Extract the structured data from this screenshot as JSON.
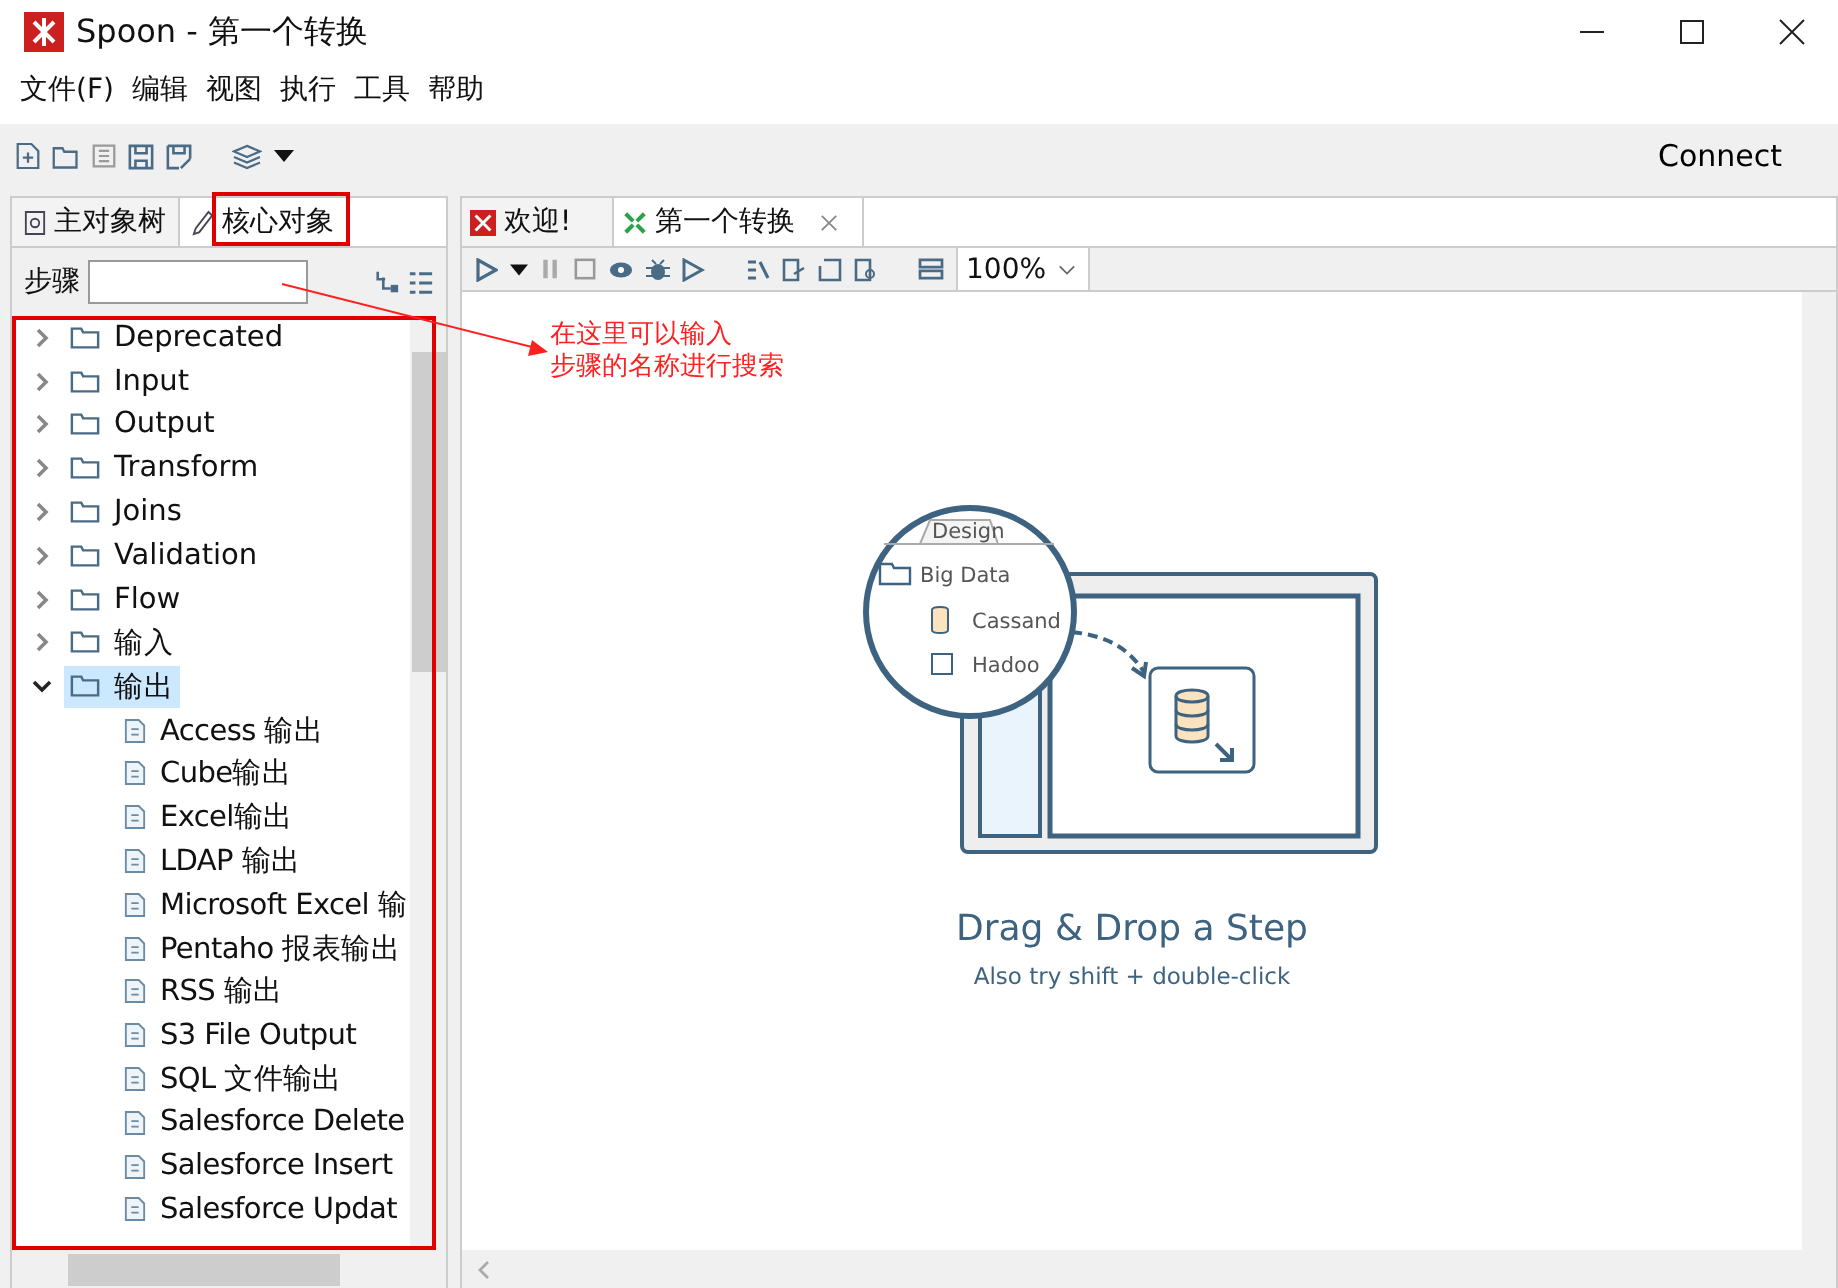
{
  "window": {
    "title": "Spoon - 第一个转换"
  },
  "menu": [
    "文件(F)",
    "编辑",
    "视图",
    "执行",
    "工具",
    "帮助"
  ],
  "toolbar": {
    "connect": "Connect"
  },
  "left_panel": {
    "tabs": [
      {
        "label": "主对象树",
        "selected": false,
        "kind": "tree"
      },
      {
        "label": "核心对象",
        "selected": true,
        "kind": "core"
      }
    ],
    "search": {
      "label": "步骤"
    },
    "tree": [
      {
        "label": "Deprecated",
        "expanded": false,
        "selected": false
      },
      {
        "label": "Input",
        "expanded": false,
        "selected": false
      },
      {
        "label": "Output",
        "expanded": false,
        "selected": false
      },
      {
        "label": "Transform",
        "expanded": false,
        "selected": false
      },
      {
        "label": "Joins",
        "expanded": false,
        "selected": false
      },
      {
        "label": "Validation",
        "expanded": false,
        "selected": false
      },
      {
        "label": "Flow",
        "expanded": false,
        "selected": false
      },
      {
        "label": "输入",
        "expanded": false,
        "selected": false
      },
      {
        "label": "输出",
        "expanded": true,
        "selected": true,
        "children": [
          {
            "label": "Access 输出"
          },
          {
            "label": "Cube输出"
          },
          {
            "label": "Excel输出"
          },
          {
            "label": "LDAP 输出"
          },
          {
            "label": "Microsoft Excel 输"
          },
          {
            "label": "Pentaho 报表输出"
          },
          {
            "label": "RSS 输出"
          },
          {
            "label": "S3 File Output"
          },
          {
            "label": "SQL 文件输出"
          },
          {
            "label": "Salesforce Delete"
          },
          {
            "label": "Salesforce Insert"
          },
          {
            "label": "Salesforce Updat"
          }
        ]
      }
    ]
  },
  "editor": {
    "tabs": [
      {
        "label": "欢迎!",
        "selected": false,
        "kind": "welcome",
        "closable": false
      },
      {
        "label": "第一个转换",
        "selected": true,
        "kind": "transformation",
        "closable": true
      }
    ],
    "zoom": "100%"
  },
  "canvas": {
    "illustration": {
      "tab": "Design",
      "folder": "Big Data",
      "items": [
        "Cassand",
        "Hadoo"
      ]
    },
    "headline": "Drag & Drop a Step",
    "hint": "Also try shift + double-click"
  },
  "annotation": {
    "lines": [
      "在这里可以输入",
      "步骤的名称进行搜索"
    ]
  }
}
